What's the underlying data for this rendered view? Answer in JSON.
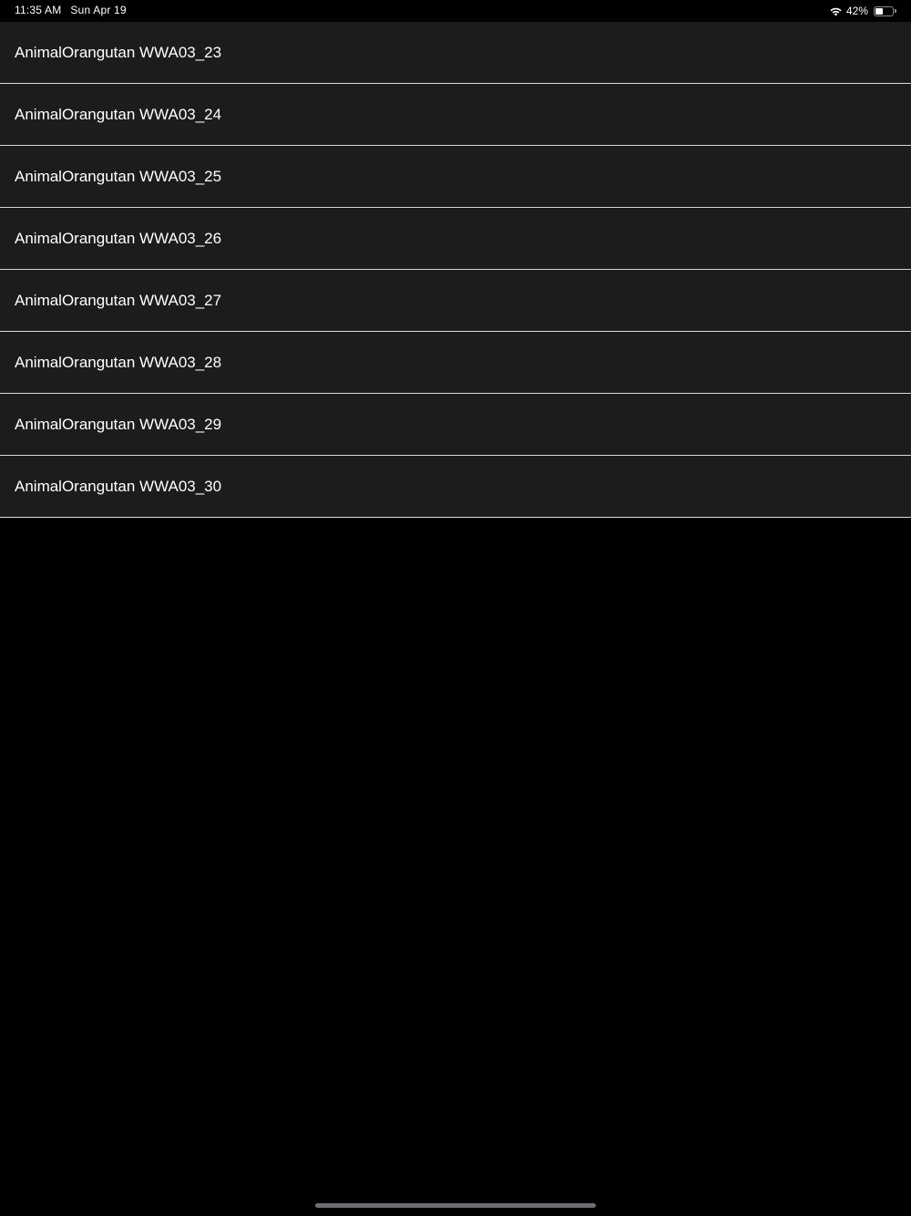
{
  "status_bar": {
    "time": "11:35 AM",
    "date": "Sun Apr 19",
    "battery_percent_label": "42%",
    "battery_level": 0.42,
    "wifi_icon": "wifi-icon",
    "battery_icon": "battery-icon"
  },
  "list": {
    "items": [
      {
        "label": "AnimalOrangutan WWA03_23"
      },
      {
        "label": "AnimalOrangutan WWA03_24"
      },
      {
        "label": "AnimalOrangutan WWA03_25"
      },
      {
        "label": "AnimalOrangutan WWA03_26"
      },
      {
        "label": "AnimalOrangutan WWA03_27"
      },
      {
        "label": "AnimalOrangutan WWA03_28"
      },
      {
        "label": "AnimalOrangutan WWA03_29"
      },
      {
        "label": "AnimalOrangutan WWA03_30"
      }
    ]
  },
  "colors": {
    "background": "#000000",
    "cell_background": "#1c1c1e",
    "separator": "#d8d8dc",
    "text": "#ffffff"
  }
}
